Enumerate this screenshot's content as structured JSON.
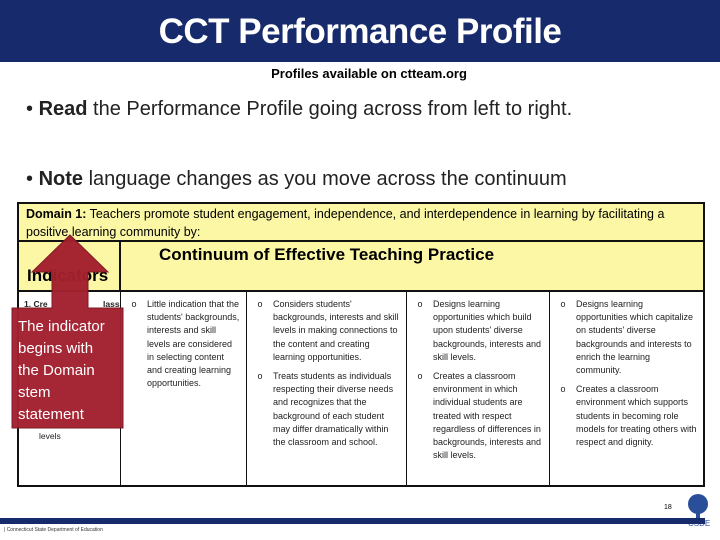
{
  "title": "CCT Performance Profile",
  "subtitle": "Profiles available on ctteam.org",
  "bullets": [
    {
      "bold": "Read",
      "rest": " the Performance Profile going across from left to right."
    },
    {
      "bold": "Note",
      "rest": " language changes as you move across the continuum"
    }
  ],
  "table": {
    "domain_label": "Domain 1:",
    "domain_text": " Teachers promote student engagement, independence, and interdependence in learning by facilitating a positive learning community by:",
    "indicators_header": "Indicators",
    "continuum_header": "Continuum of Effective Teaching Practice",
    "indicator_visible": {
      "start": "1. Cre",
      "mid": "lass",
      "end": "levels"
    },
    "columns": [
      {
        "marker": "o",
        "items": [
          "Little indication that the students' backgrounds, interests and skill levels are considered in selecting content and creating learning opportunities."
        ]
      },
      {
        "marker": "o",
        "items": [
          "Considers students' backgrounds, interests and skill levels in making connections to the content and creating learning opportunities.",
          "Treats students as individuals respecting their diverse needs and recognizes that the background of each student may differ dramatically within the classroom and school."
        ]
      },
      {
        "marker": "o",
        "items": [
          "Designs learning opportunities which build upon students' diverse backgrounds, interests and skill levels.",
          "Creates a classroom environment in which individual students are treated with respect regardless of differences in backgrounds, interests and skill levels."
        ]
      },
      {
        "marker": "o",
        "items": [
          "Designs learning opportunities which capitalize on students' diverse backgrounds and interests to enrich the learning community.",
          "Creates a classroom environment which supports students in becoming role models for treating others with respect and dignity."
        ]
      }
    ]
  },
  "callout": "The indicator begins with the Domain stem statement",
  "footer": "| Connecticut State Department of Education",
  "page_number": "18",
  "logo_text": "CSDE",
  "colors": {
    "navy": "#172a6b",
    "header_yellow": "#fbf7a4",
    "callout_red": "#a3202e"
  }
}
